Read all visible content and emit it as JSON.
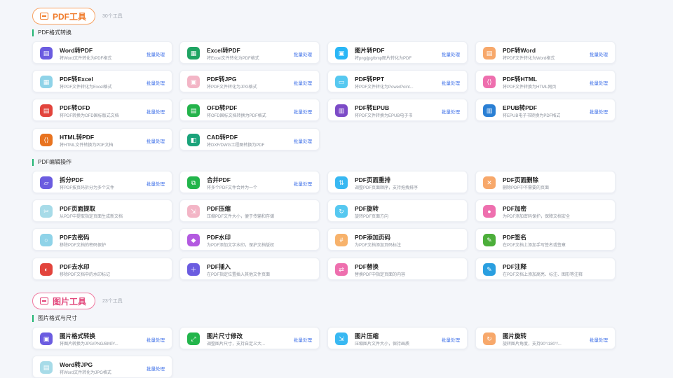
{
  "groups": {
    "pdf": {
      "label": "PDF工具",
      "count": "30个工具",
      "color": "#f07b2a"
    },
    "img": {
      "label": "图片工具",
      "count": "23个工具",
      "color": "#e2457a"
    }
  },
  "sections": {
    "pdf_format": "PDF格式转换",
    "pdf_edit": "PDF编辑操作",
    "img_format": "图片格式与尺寸"
  },
  "batch_label": "批量处理",
  "cards": {
    "word2pdf": {
      "title": "Word转PDF",
      "desc": "将Word文件转化为PDF格式",
      "icon": "document-icon",
      "color": "#6b5ce0"
    },
    "excel2pdf": {
      "title": "Excel转PDF",
      "desc": "将Excel文件转化为PDF格式",
      "icon": "spreadsheet-icon",
      "color": "#1fa463"
    },
    "img2pdf": {
      "title": "图片转PDF",
      "desc": "将png/jpg/bmp图片转化为PDF",
      "icon": "image-icon",
      "color": "#29b6f6"
    },
    "pdf2word": {
      "title": "PDF转Word",
      "desc": "将PDF文件转化为Word格式",
      "icon": "document-icon",
      "color": "#f7a86b"
    },
    "pdf2excel": {
      "title": "PDF转Excel",
      "desc": "将PDF文件转化为Excel格式",
      "icon": "spreadsheet-icon",
      "color": "#8fd3e8"
    },
    "pdf2jpg": {
      "title": "PDF转JPG",
      "desc": "将PDF文件转化为JPG格式",
      "icon": "image-icon",
      "color": "#f3b5c6"
    },
    "pdf2ppt": {
      "title": "PDF转PPT",
      "desc": "将PDF文件转化为PowerPoint...",
      "icon": "slides-icon",
      "color": "#56c8f0"
    },
    "pdf2html": {
      "title": "PDF转HTML",
      "desc": "将PDF文件转换为HTML网页",
      "icon": "code-icon",
      "color": "#ee6fae"
    },
    "pdf2ofd": {
      "title": "PDF转OFD",
      "desc": "将PDF转换为OFD国标版式文档",
      "icon": "document-icon",
      "color": "#e2443c"
    },
    "ofd2pdf": {
      "title": "OFD转PDF",
      "desc": "将OFD国标文档转换为PDF格式",
      "icon": "document-icon",
      "color": "#23b34a"
    },
    "pdf2epub": {
      "title": "PDF转EPUB",
      "desc": "将PDF文件转换为EPUB电子书",
      "icon": "book-icon",
      "color": "#7c4bc7"
    },
    "epub2pdf": {
      "title": "EPUB转PDF",
      "desc": "将EPUB电子书转换为PDF格式",
      "icon": "book-icon",
      "color": "#2a7fd4"
    },
    "html2pdf": {
      "title": "HTML转PDF",
      "desc": "将HTML文件转换为PDF文档",
      "icon": "code-icon",
      "color": "#e8731f"
    },
    "cad2pdf": {
      "title": "CAD转PDF",
      "desc": "将DXF/DWG工程图转换为PDF",
      "icon": "drawing-icon",
      "color": "#1aa37a"
    },
    "split": {
      "title": "拆分PDF",
      "desc": "将PDF按页码拆分为多个文件",
      "icon": "folder-icon",
      "color": "#6b5ce0"
    },
    "merge": {
      "title": "合并PDF",
      "desc": "将多个PDF文件合并为一个",
      "icon": "merge-icon",
      "color": "#22b54b"
    },
    "reorder": {
      "title": "PDF页面重排",
      "desc": "调整PDF页面顺序，支持拖拽排序",
      "icon": "sort-icon",
      "color": "#38b8f2"
    },
    "delpage": {
      "title": "PDF页面删除",
      "desc": "删除PDF中不需要的页面",
      "icon": "delete-icon",
      "color": "#f7a86b"
    },
    "extract": {
      "title": "PDF页面提取",
      "desc": "从PDF中提取指定页面生成新文档",
      "icon": "scissors-icon",
      "color": "#a7dbe8"
    },
    "compress": {
      "title": "PDF压缩",
      "desc": "压缩PDF文件大小，便于传输和存储",
      "icon": "compress-icon",
      "color": "#f3b5c6"
    },
    "rotate": {
      "title": "PDF旋转",
      "desc": "旋转PDF页面方向",
      "icon": "rotate-icon",
      "color": "#56c8f0"
    },
    "encrypt": {
      "title": "PDF加密",
      "desc": "为PDF添加密码保护，保障文档安全",
      "icon": "lock-icon",
      "color": "#ee6fae"
    },
    "decrypt": {
      "title": "PDF去密码",
      "desc": "移除PDF文档的密码保护",
      "icon": "unlock-icon",
      "color": "#8fd3e8"
    },
    "watermark": {
      "title": "PDF水印",
      "desc": "为PDF添加文字水印，保护文档版权",
      "icon": "stamp-icon",
      "color": "#b35ae0"
    },
    "pagenum": {
      "title": "PDF添加页码",
      "desc": "为PDF文档添加页码标注",
      "icon": "number-icon",
      "color": "#f7b26b"
    },
    "sign": {
      "title": "PDF签名",
      "desc": "在PDF文档上添加手写签名或签章",
      "icon": "signature-icon",
      "color": "#4cae3a"
    },
    "dewatermark": {
      "title": "PDF去水印",
      "desc": "移除PDF文档中的水印标记",
      "icon": "eraser-icon",
      "color": "#e2443c"
    },
    "insert": {
      "title": "PDF插入",
      "desc": "在PDF指定位置插入其他文件页面",
      "icon": "insert-icon",
      "color": "#6b5ce0"
    },
    "replace": {
      "title": "PDF替换",
      "desc": "替换PDF中指定页面的内容",
      "icon": "replace-icon",
      "color": "#ee6fae"
    },
    "annotate": {
      "title": "PDF注释",
      "desc": "在PDF文档上添加高亮、标注、图形等注释",
      "icon": "pen-icon",
      "color": "#2a9fe0"
    },
    "imgconv": {
      "title": "图片格式转换",
      "desc": "将图片转换为JPG/PNG/BMP/...",
      "icon": "image-icon",
      "color": "#6b5ce0"
    },
    "imgresize": {
      "title": "图片尺寸修改",
      "desc": "调整图片尺寸，支持自定义大...",
      "icon": "resize-icon",
      "color": "#22b54b"
    },
    "imgcompress": {
      "title": "图片压缩",
      "desc": "压缩图片文件大小，保持画质",
      "icon": "compress-icon",
      "color": "#38b8f2"
    },
    "imgrotate": {
      "title": "图片旋转",
      "desc": "旋转图片角度，支持90°/180°/...",
      "icon": "rotate-icon",
      "color": "#f7a86b"
    },
    "word2jpg": {
      "title": "Word转JPG",
      "desc": "将Word文件转化为JPG格式",
      "icon": "document-icon",
      "color": "#a7dbe8"
    }
  }
}
